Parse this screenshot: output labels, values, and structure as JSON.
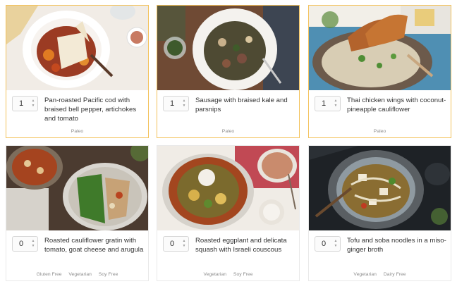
{
  "meals": [
    {
      "quantity": "1",
      "title": "Pan-roasted Pacific cod with braised bell pepper, artichokes and tomato",
      "tags": [
        "Paleo"
      ],
      "selected": true
    },
    {
      "quantity": "1",
      "title": "Sausage with braised kale and parsnips",
      "tags": [
        "Paleo"
      ],
      "selected": true
    },
    {
      "quantity": "1",
      "title": "Thai chicken wings with coconut-pineapple cauliflower",
      "tags": [
        "Paleo"
      ],
      "selected": true
    },
    {
      "quantity": "0",
      "title": "Roasted cauliflower gratin with tomato, goat cheese and arugula",
      "tags": [
        "Gluten Free",
        "Vegetarian",
        "Soy Free"
      ],
      "selected": false
    },
    {
      "quantity": "0",
      "title": "Roasted eggplant and delicata squash with Israeli couscous",
      "tags": [
        "Vegetarian",
        "Soy Free"
      ],
      "selected": false
    },
    {
      "quantity": "0",
      "title": "Tofu and soba noodles in a miso-ginger broth",
      "tags": [
        "Vegetarian",
        "Dairy Free"
      ],
      "selected": false
    }
  ],
  "colors": {
    "selected_border": "#f3c25c",
    "unselected_border": "#e9e9e9",
    "title_text": "#333333",
    "tag_text": "#8d8d8d"
  },
  "icons": {
    "stepper": "up-down-arrows-icon"
  }
}
